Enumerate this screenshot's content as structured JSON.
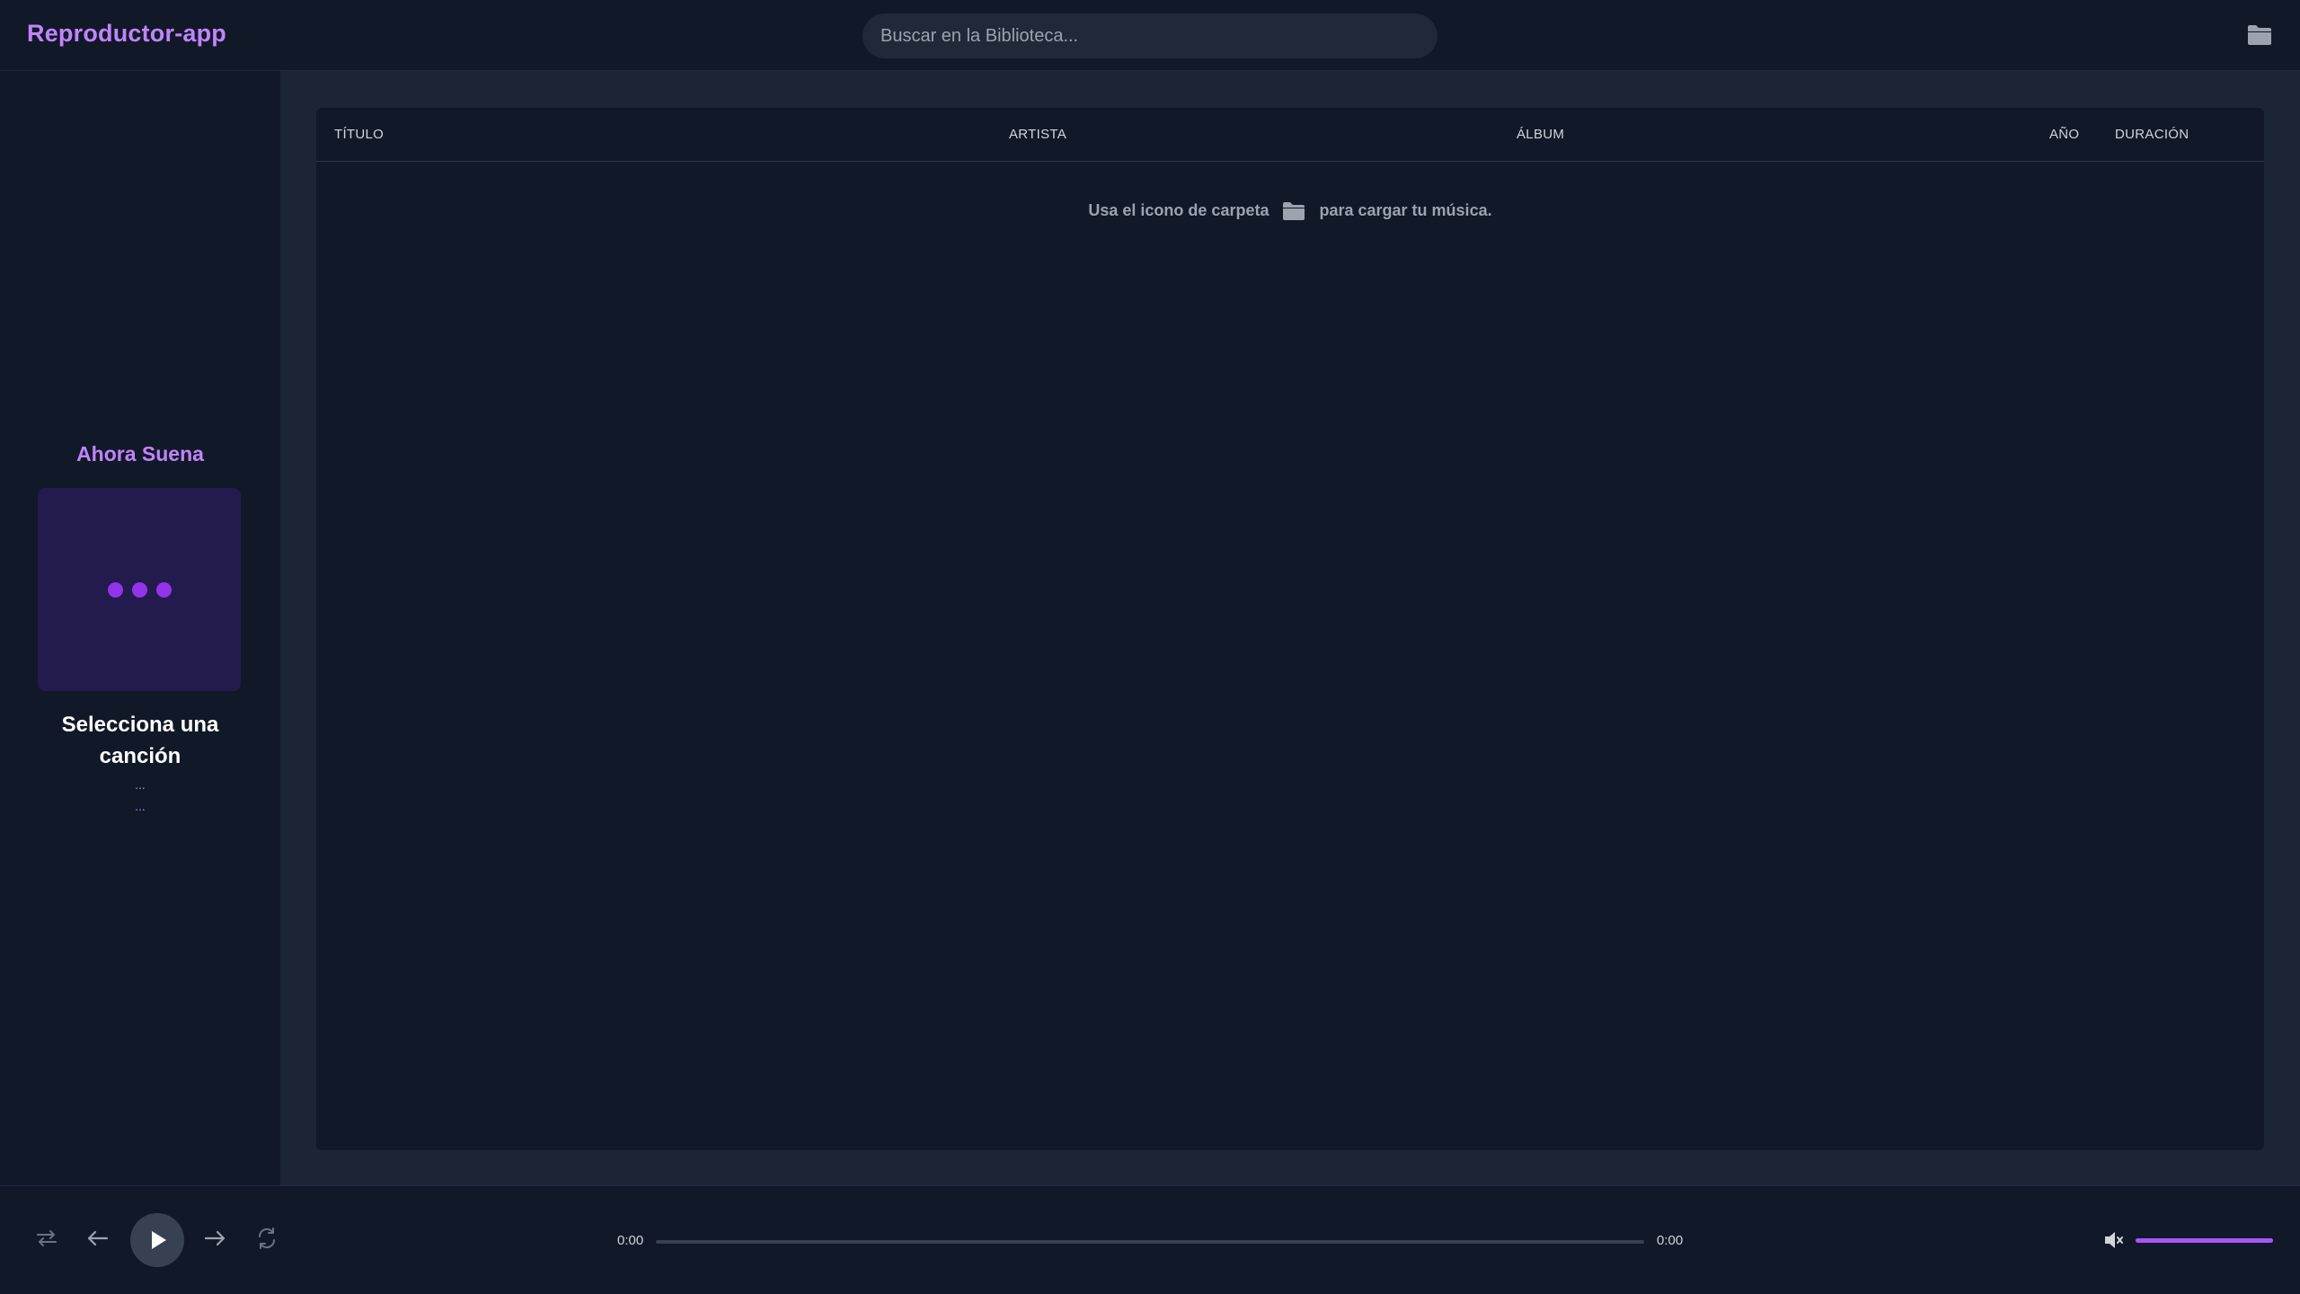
{
  "app": {
    "title": "Reproductor-app"
  },
  "header": {
    "search_placeholder": "Buscar en la Biblioteca...",
    "folder_icon": "folder-icon"
  },
  "sidebar": {
    "now_playing_label": "Ahora Suena",
    "song_title": "Selecciona una canción",
    "song_artist": "...",
    "song_album": "..."
  },
  "table": {
    "columns": [
      "TÍTULO",
      "ARTISTA",
      "ÁLBUM",
      "AÑO",
      "DURACIÓN"
    ],
    "empty_message_before": "Usa el icono de carpeta",
    "empty_message_after": "para cargar tu música."
  },
  "player": {
    "current_time": "0:00",
    "total_time": "0:00",
    "progress": 0,
    "volume": 1.0,
    "controls": [
      "shuffle-icon",
      "previous-icon",
      "play-icon",
      "next-icon",
      "repeat-icon"
    ]
  },
  "colors": {
    "accent": "#c084fc",
    "accent_strong": "#9333ea",
    "background": "#111827",
    "panel": "#1b2533"
  }
}
